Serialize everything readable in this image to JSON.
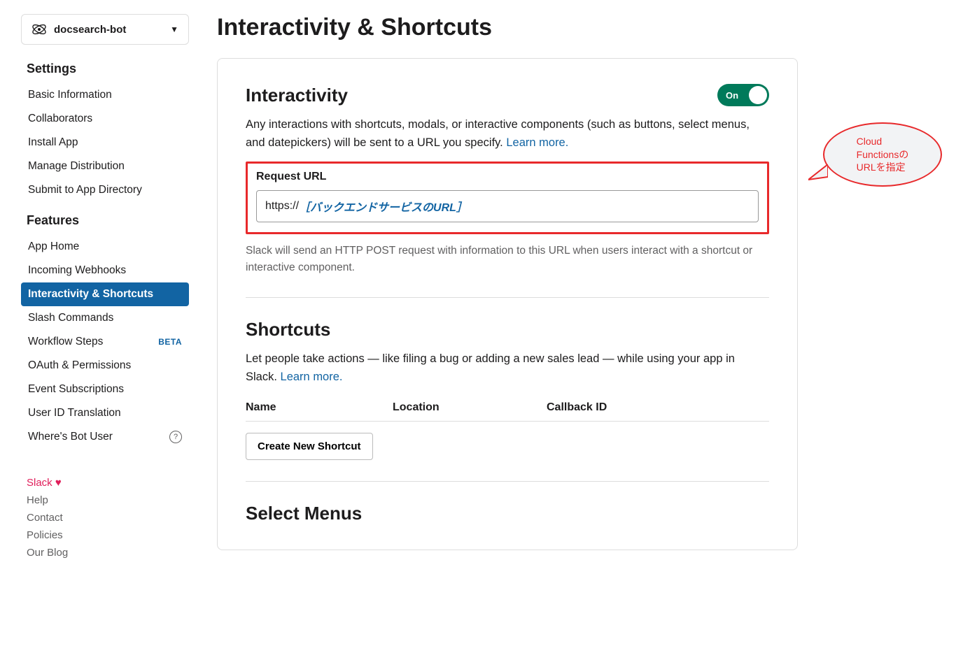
{
  "app_selector": {
    "name": "docsearch-bot"
  },
  "sidebar": {
    "settings_heading": "Settings",
    "settings_items": [
      {
        "label": "Basic Information"
      },
      {
        "label": "Collaborators"
      },
      {
        "label": "Install App"
      },
      {
        "label": "Manage Distribution"
      },
      {
        "label": "Submit to App Directory"
      }
    ],
    "features_heading": "Features",
    "features_items": [
      {
        "label": "App Home"
      },
      {
        "label": "Incoming Webhooks"
      },
      {
        "label": "Interactivity & Shortcuts",
        "active": true
      },
      {
        "label": "Slash Commands"
      },
      {
        "label": "Workflow Steps",
        "badge": "BETA"
      },
      {
        "label": "OAuth & Permissions"
      },
      {
        "label": "Event Subscriptions"
      },
      {
        "label": "User ID Translation"
      },
      {
        "label": "Where's Bot User",
        "help": true
      }
    ],
    "footer": {
      "brand": "Slack",
      "links": [
        "Help",
        "Contact",
        "Policies",
        "Our Blog"
      ]
    }
  },
  "page_title": "Interactivity & Shortcuts",
  "interactivity": {
    "title": "Interactivity",
    "toggle_label": "On",
    "description": "Any interactions with shortcuts, modals, or interactive components (such as buttons, select menus, and datepickers) will be sent to a URL you specify. ",
    "learn_more": "Learn more.",
    "request_url_label": "Request URL",
    "url_prefix": "https://",
    "url_placeholder": "［バックエンドサービスのURL］",
    "help_text": "Slack will send an HTTP POST request with information to this URL when users interact with a shortcut or interactive component."
  },
  "shortcuts": {
    "title": "Shortcuts",
    "description": "Let people take actions — like filing a bug or adding a new sales lead — while using your app in Slack. ",
    "learn_more": "Learn more.",
    "columns": {
      "name": "Name",
      "location": "Location",
      "callback": "Callback ID"
    },
    "create_button": "Create New Shortcut"
  },
  "select_menus": {
    "title": "Select Menus"
  },
  "callout": {
    "line1": "Cloud",
    "line2": "Functionsの",
    "line3": "URLを指定"
  }
}
